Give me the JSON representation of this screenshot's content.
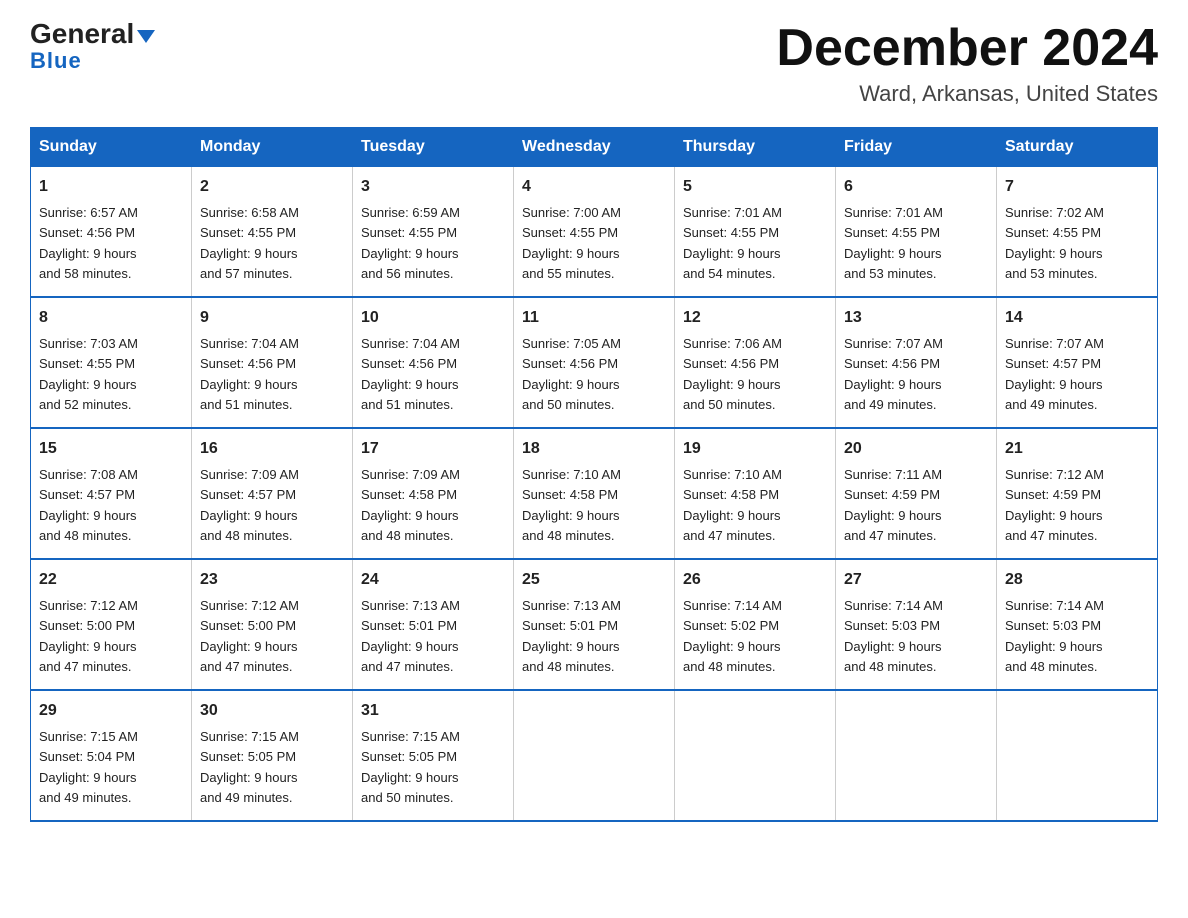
{
  "header": {
    "logo_general": "General",
    "logo_blue": "Blue",
    "month_title": "December 2024",
    "location": "Ward, Arkansas, United States"
  },
  "days_of_week": [
    "Sunday",
    "Monday",
    "Tuesday",
    "Wednesday",
    "Thursday",
    "Friday",
    "Saturday"
  ],
  "weeks": [
    [
      {
        "num": "1",
        "sunrise": "6:57 AM",
        "sunset": "4:56 PM",
        "daylight": "9 hours and 58 minutes."
      },
      {
        "num": "2",
        "sunrise": "6:58 AM",
        "sunset": "4:55 PM",
        "daylight": "9 hours and 57 minutes."
      },
      {
        "num": "3",
        "sunrise": "6:59 AM",
        "sunset": "4:55 PM",
        "daylight": "9 hours and 56 minutes."
      },
      {
        "num": "4",
        "sunrise": "7:00 AM",
        "sunset": "4:55 PM",
        "daylight": "9 hours and 55 minutes."
      },
      {
        "num": "5",
        "sunrise": "7:01 AM",
        "sunset": "4:55 PM",
        "daylight": "9 hours and 54 minutes."
      },
      {
        "num": "6",
        "sunrise": "7:01 AM",
        "sunset": "4:55 PM",
        "daylight": "9 hours and 53 minutes."
      },
      {
        "num": "7",
        "sunrise": "7:02 AM",
        "sunset": "4:55 PM",
        "daylight": "9 hours and 53 minutes."
      }
    ],
    [
      {
        "num": "8",
        "sunrise": "7:03 AM",
        "sunset": "4:55 PM",
        "daylight": "9 hours and 52 minutes."
      },
      {
        "num": "9",
        "sunrise": "7:04 AM",
        "sunset": "4:56 PM",
        "daylight": "9 hours and 51 minutes."
      },
      {
        "num": "10",
        "sunrise": "7:04 AM",
        "sunset": "4:56 PM",
        "daylight": "9 hours and 51 minutes."
      },
      {
        "num": "11",
        "sunrise": "7:05 AM",
        "sunset": "4:56 PM",
        "daylight": "9 hours and 50 minutes."
      },
      {
        "num": "12",
        "sunrise": "7:06 AM",
        "sunset": "4:56 PM",
        "daylight": "9 hours and 50 minutes."
      },
      {
        "num": "13",
        "sunrise": "7:07 AM",
        "sunset": "4:56 PM",
        "daylight": "9 hours and 49 minutes."
      },
      {
        "num": "14",
        "sunrise": "7:07 AM",
        "sunset": "4:57 PM",
        "daylight": "9 hours and 49 minutes."
      }
    ],
    [
      {
        "num": "15",
        "sunrise": "7:08 AM",
        "sunset": "4:57 PM",
        "daylight": "9 hours and 48 minutes."
      },
      {
        "num": "16",
        "sunrise": "7:09 AM",
        "sunset": "4:57 PM",
        "daylight": "9 hours and 48 minutes."
      },
      {
        "num": "17",
        "sunrise": "7:09 AM",
        "sunset": "4:58 PM",
        "daylight": "9 hours and 48 minutes."
      },
      {
        "num": "18",
        "sunrise": "7:10 AM",
        "sunset": "4:58 PM",
        "daylight": "9 hours and 48 minutes."
      },
      {
        "num": "19",
        "sunrise": "7:10 AM",
        "sunset": "4:58 PM",
        "daylight": "9 hours and 47 minutes."
      },
      {
        "num": "20",
        "sunrise": "7:11 AM",
        "sunset": "4:59 PM",
        "daylight": "9 hours and 47 minutes."
      },
      {
        "num": "21",
        "sunrise": "7:12 AM",
        "sunset": "4:59 PM",
        "daylight": "9 hours and 47 minutes."
      }
    ],
    [
      {
        "num": "22",
        "sunrise": "7:12 AM",
        "sunset": "5:00 PM",
        "daylight": "9 hours and 47 minutes."
      },
      {
        "num": "23",
        "sunrise": "7:12 AM",
        "sunset": "5:00 PM",
        "daylight": "9 hours and 47 minutes."
      },
      {
        "num": "24",
        "sunrise": "7:13 AM",
        "sunset": "5:01 PM",
        "daylight": "9 hours and 47 minutes."
      },
      {
        "num": "25",
        "sunrise": "7:13 AM",
        "sunset": "5:01 PM",
        "daylight": "9 hours and 48 minutes."
      },
      {
        "num": "26",
        "sunrise": "7:14 AM",
        "sunset": "5:02 PM",
        "daylight": "9 hours and 48 minutes."
      },
      {
        "num": "27",
        "sunrise": "7:14 AM",
        "sunset": "5:03 PM",
        "daylight": "9 hours and 48 minutes."
      },
      {
        "num": "28",
        "sunrise": "7:14 AM",
        "sunset": "5:03 PM",
        "daylight": "9 hours and 48 minutes."
      }
    ],
    [
      {
        "num": "29",
        "sunrise": "7:15 AM",
        "sunset": "5:04 PM",
        "daylight": "9 hours and 49 minutes."
      },
      {
        "num": "30",
        "sunrise": "7:15 AM",
        "sunset": "5:05 PM",
        "daylight": "9 hours and 49 minutes."
      },
      {
        "num": "31",
        "sunrise": "7:15 AM",
        "sunset": "5:05 PM",
        "daylight": "9 hours and 50 minutes."
      },
      null,
      null,
      null,
      null
    ]
  ],
  "labels": {
    "sunrise": "Sunrise:",
    "sunset": "Sunset:",
    "daylight": "Daylight:"
  }
}
